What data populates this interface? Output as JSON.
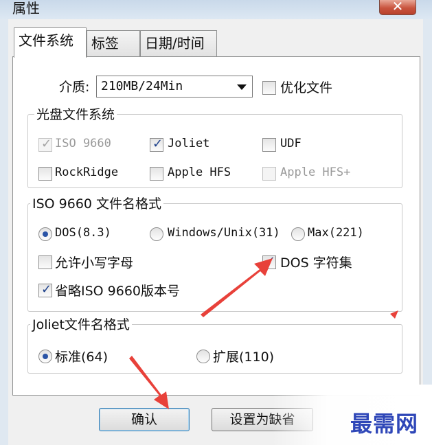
{
  "window": {
    "title": "属性",
    "close_label": "✕"
  },
  "tabs": [
    {
      "label": "文件系统",
      "active": true
    },
    {
      "label": "标签",
      "active": false
    },
    {
      "label": "日期/时间",
      "active": false
    }
  ],
  "media": {
    "label": "介质:",
    "value": "210MB/24Min",
    "optimize_label": "优化文件",
    "optimize_checked": false
  },
  "disc_fs": {
    "title": "光盘文件系统",
    "options": [
      {
        "label": "ISO 9660",
        "checked": true,
        "disabled": true
      },
      {
        "label": "Joliet",
        "checked": true,
        "disabled": false
      },
      {
        "label": "UDF",
        "checked": false,
        "disabled": false
      },
      {
        "label": "RockRidge",
        "checked": false,
        "disabled": false
      },
      {
        "label": "Apple HFS",
        "checked": false,
        "disabled": false
      },
      {
        "label": "Apple HFS+",
        "checked": false,
        "disabled": true
      }
    ]
  },
  "iso_format": {
    "title": "ISO 9660 文件名格式",
    "radios": [
      {
        "label": "DOS(8.3)",
        "selected": true
      },
      {
        "label": "Windows/Unix(31)",
        "selected": false
      },
      {
        "label": "Max(221)",
        "selected": false
      }
    ],
    "allow_lowercase": {
      "label": "允许小写字母",
      "checked": false
    },
    "dos_charset": {
      "label": "DOS 字符集",
      "checked": true
    },
    "omit_version": {
      "label": "省略ISO 9660版本号",
      "checked": true
    }
  },
  "joliet_format": {
    "title": "Joliet文件名格式",
    "radios": [
      {
        "label": "标准(64)",
        "selected": true
      },
      {
        "label": "扩展(110)",
        "selected": false
      }
    ]
  },
  "buttons": {
    "ok": "确认",
    "set_default": "设置为缺省"
  },
  "watermark": "最需网",
  "colors": {
    "annotation_arrow": "#e8413a",
    "watermark": "#2f47b8"
  }
}
